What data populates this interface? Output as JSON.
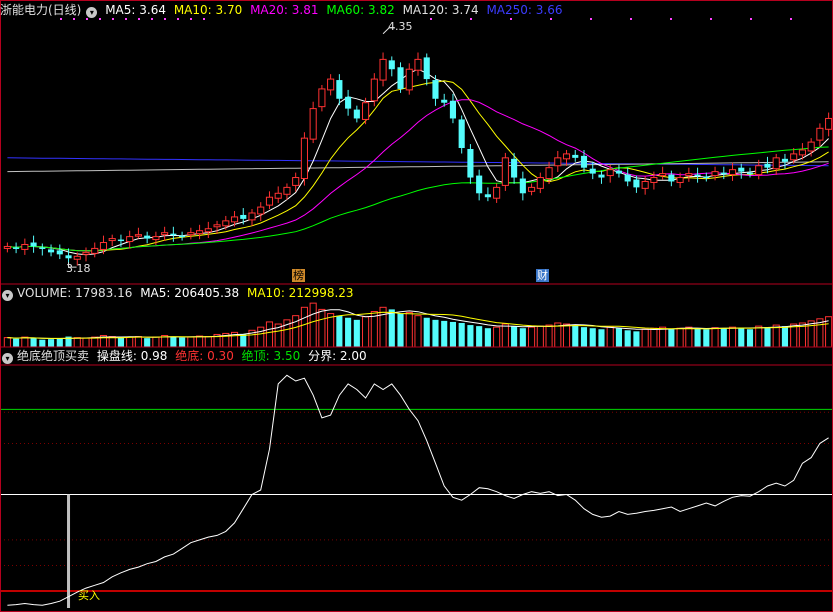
{
  "main_header": {
    "stock_name": "浙能电力(日线)",
    "ma5": "MA5: 3.64",
    "ma10": "MA10: 3.70",
    "ma20": "MA20: 3.81",
    "ma60": "MA60: 3.82",
    "ma120": "MA120: 3.74",
    "ma250": "MA250: 3.66"
  },
  "volume_header": {
    "volume": "VOLUME: 17983.16",
    "ma5": "MA5: 206405.38",
    "ma10": "MA10: 212998.23"
  },
  "indicator_header": {
    "name": "绝底绝顶买卖",
    "control_line": "操盘线: 0.98",
    "bottom": "绝底: 0.30",
    "top": "绝顶: 3.50",
    "divider": "分界: 2.00"
  },
  "annotations": {
    "high_label": "4.35",
    "low_label": "3.18",
    "bang_tag": "榜",
    "cai_tag": "财",
    "buy_label": "买入"
  },
  "colors": {
    "background": "#000000",
    "up_candle": "#ff3232",
    "down_candle": "#54fcfc",
    "ma5": "#ffffff",
    "ma10": "#ffff00",
    "ma20": "#ff00ff",
    "ma60": "#00ff00",
    "ma120": "#c0c0c0",
    "ma250": "#3232ff",
    "panel_border": "#b4001e",
    "bottom_line": "#ff0000",
    "top_line": "#00d800",
    "divider_line": "#ffffff",
    "control_line": "#ffffff"
  },
  "chart_data": [
    {
      "type": "candlestick",
      "panel": "price",
      "ylim": [
        3.1,
        4.4
      ],
      "annotations": [
        {
          "text": "4.35",
          "value": 4.35
        },
        {
          "text": "3.18",
          "value": 3.18
        }
      ],
      "closes": [
        3.25,
        3.24,
        3.26,
        3.25,
        3.24,
        3.22,
        3.21,
        3.19,
        3.2,
        3.22,
        3.24,
        3.27,
        3.29,
        3.28,
        3.3,
        3.31,
        3.29,
        3.3,
        3.32,
        3.31,
        3.3,
        3.32,
        3.33,
        3.34,
        3.36,
        3.38,
        3.4,
        3.39,
        3.42,
        3.45,
        3.5,
        3.52,
        3.55,
        3.6,
        3.8,
        3.95,
        4.05,
        4.1,
        4.0,
        3.95,
        3.9,
        3.98,
        4.1,
        4.2,
        4.15,
        4.05,
        4.15,
        4.2,
        4.1,
        4.0,
        3.98,
        3.9,
        3.75,
        3.6,
        3.52,
        3.5,
        3.55,
        3.7,
        3.6,
        3.52,
        3.55,
        3.6,
        3.65,
        3.7,
        3.72,
        3.7,
        3.65,
        3.62,
        3.6,
        3.64,
        3.62,
        3.58,
        3.55,
        3.58,
        3.6,
        3.62,
        3.58,
        3.6,
        3.62,
        3.61,
        3.6,
        3.63,
        3.62,
        3.64,
        3.63,
        3.62,
        3.66,
        3.65,
        3.7,
        3.68,
        3.72,
        3.74,
        3.78,
        3.85,
        3.9
      ]
    },
    {
      "type": "bar",
      "panel": "volume",
      "ylim": [
        0,
        450000
      ],
      "values": [
        90,
        80,
        95,
        85,
        70,
        75,
        80,
        100,
        90,
        85,
        95,
        110,
        100,
        90,
        95,
        100,
        85,
        95,
        110,
        100,
        90,
        95,
        105,
        100,
        120,
        130,
        140,
        120,
        160,
        190,
        240,
        220,
        260,
        300,
        380,
        420,
        360,
        320,
        300,
        280,
        260,
        290,
        340,
        380,
        360,
        320,
        330,
        300,
        280,
        260,
        250,
        240,
        230,
        210,
        200,
        180,
        190,
        220,
        200,
        180,
        190,
        200,
        210,
        230,
        220,
        210,
        190,
        180,
        170,
        190,
        180,
        160,
        150,
        170,
        180,
        190,
        170,
        180,
        190,
        175,
        170,
        185,
        180,
        190,
        185,
        170,
        200,
        190,
        210,
        200,
        220,
        230,
        250,
        270,
        290
      ]
    },
    {
      "type": "line",
      "panel": "indicator",
      "ylim": [
        0,
        4.3
      ],
      "series": [
        {
          "name": "操盘线",
          "values": [
            0.05,
            0.06,
            0.08,
            0.06,
            0.05,
            0.08,
            0.12,
            0.2,
            0.28,
            0.35,
            0.4,
            0.45,
            0.55,
            0.62,
            0.68,
            0.72,
            0.78,
            0.82,
            0.9,
            0.95,
            1.05,
            1.15,
            1.2,
            1.25,
            1.28,
            1.35,
            1.5,
            1.75,
            2.0,
            2.08,
            2.8,
            3.95,
            4.1,
            4.0,
            4.05,
            3.75,
            3.35,
            3.4,
            3.75,
            3.95,
            3.85,
            3.7,
            3.95,
            3.85,
            3.95,
            3.75,
            3.5,
            3.3,
            2.95,
            2.55,
            2.15,
            1.95,
            1.9,
            2.0,
            2.12,
            2.1,
            2.05,
            1.98,
            1.93,
            2.0,
            2.05,
            2.02,
            2.05,
            1.98,
            2.0,
            1.9,
            1.75,
            1.65,
            1.6,
            1.62,
            1.7,
            1.65,
            1.67,
            1.7,
            1.72,
            1.75,
            1.78,
            1.7,
            1.75,
            1.8,
            1.85,
            1.8,
            1.88,
            1.95,
            1.98,
            1.97,
            2.05,
            2.15,
            2.2,
            2.15,
            2.25,
            2.55,
            2.65,
            2.9,
            3.0
          ]
        },
        {
          "name": "绝底",
          "values": [
            0.3
          ]
        },
        {
          "name": "绝顶",
          "values": [
            3.5
          ]
        },
        {
          "name": "分界",
          "values": [
            2.0
          ]
        }
      ]
    }
  ]
}
